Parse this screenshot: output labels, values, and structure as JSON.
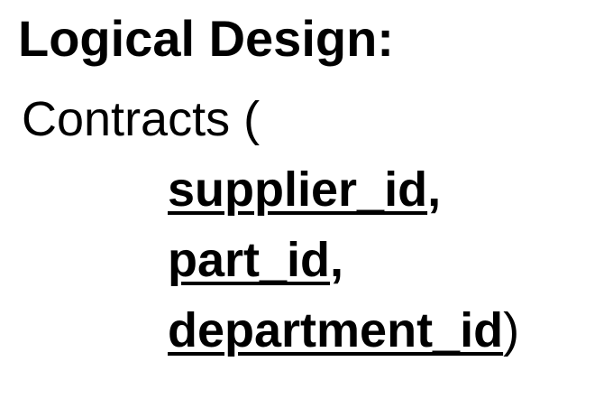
{
  "title": "Logical Design:",
  "relation": {
    "name": "Contracts",
    "open": "(",
    "close": ")",
    "attributes": [
      {
        "name": "supplier_id",
        "separator": ","
      },
      {
        "name": "part_id",
        "separator": ","
      },
      {
        "name": "department_id",
        "separator": ""
      }
    ]
  }
}
